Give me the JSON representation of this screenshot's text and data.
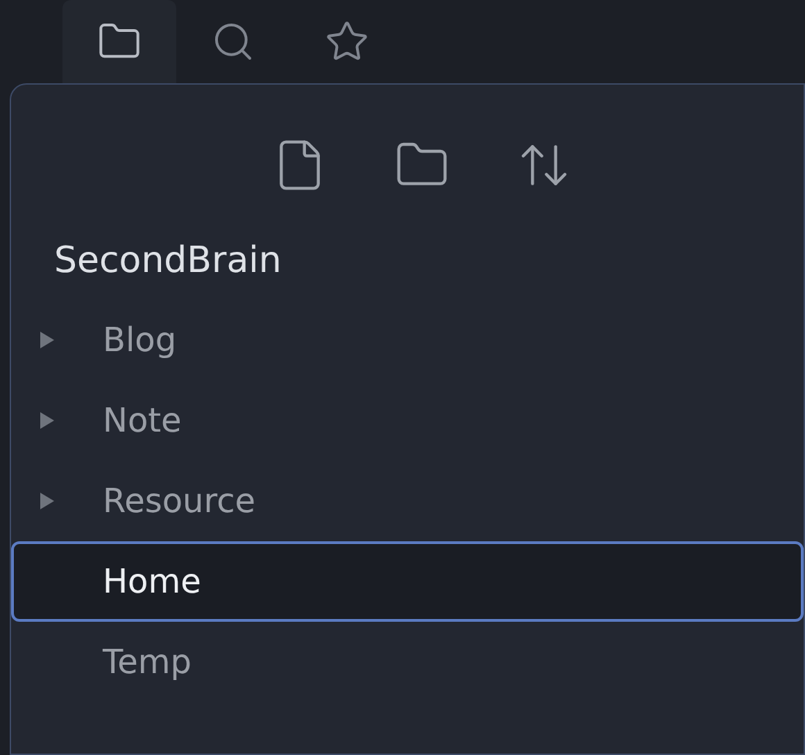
{
  "tabs": [
    {
      "kind": "files",
      "selected": true
    },
    {
      "kind": "search",
      "selected": false
    },
    {
      "kind": "bookmarks",
      "selected": false
    }
  ],
  "vault": {
    "name": "SecondBrain"
  },
  "items": [
    {
      "kind": "folder",
      "label": "Blog",
      "expanded": false,
      "selected": false
    },
    {
      "kind": "folder",
      "label": "Note",
      "expanded": false,
      "selected": false
    },
    {
      "kind": "folder",
      "label": "Resource",
      "expanded": false,
      "selected": false
    },
    {
      "kind": "file",
      "label": "Home",
      "selected": true
    },
    {
      "kind": "file",
      "label": "Temp",
      "selected": false
    }
  ]
}
